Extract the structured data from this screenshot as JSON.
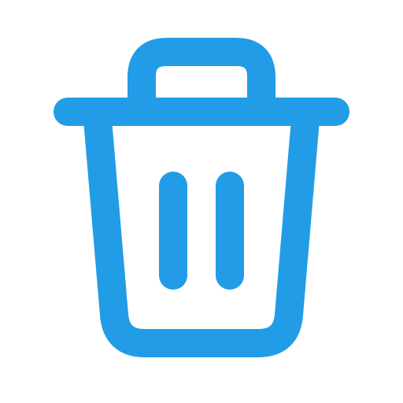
{
  "icon": {
    "name": "trash-can-icon",
    "stroke_color": "#229CE6",
    "background_color": "#FFFFFF"
  }
}
